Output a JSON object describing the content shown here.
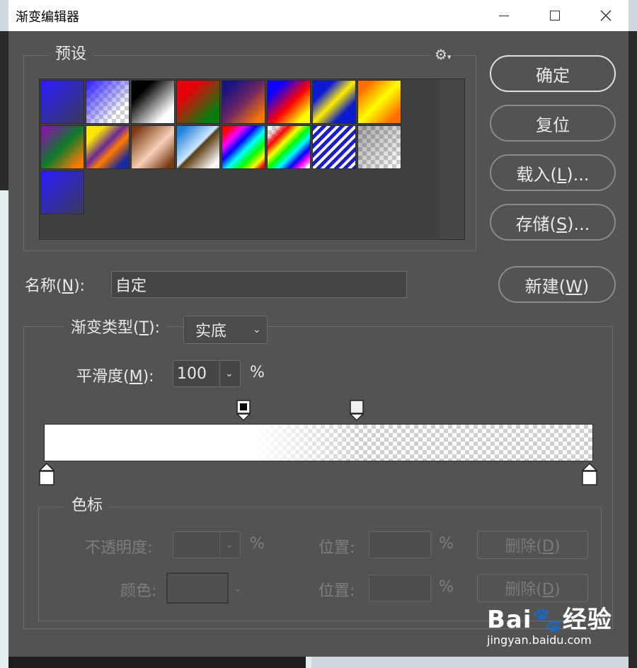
{
  "window": {
    "title": "渐变编辑器"
  },
  "presets": {
    "legend": "预设",
    "gear_icon": "gear-icon",
    "swatches": [
      {
        "name": "gradient-blue-gray"
      },
      {
        "name": "gradient-blue-transparent"
      },
      {
        "name": "gradient-black-white"
      },
      {
        "name": "gradient-red-green"
      },
      {
        "name": "gradient-violet-orange"
      },
      {
        "name": "gradient-blue-red-yellow"
      },
      {
        "name": "gradient-blue-yellow-blue"
      },
      {
        "name": "gradient-orange-yellow-orange"
      },
      {
        "name": "gradient-violet-green-orange"
      },
      {
        "name": "gradient-yellow-violet-orange-blue"
      },
      {
        "name": "gradient-copper"
      },
      {
        "name": "gradient-chrome"
      },
      {
        "name": "gradient-spectrum"
      },
      {
        "name": "gradient-transparent-rainbow"
      },
      {
        "name": "gradient-transparent-stripes"
      },
      {
        "name": "gradient-neutral-density"
      },
      {
        "name": "gradient-blue-gray-custom"
      }
    ]
  },
  "buttons": {
    "ok": "确定",
    "reset": "复位",
    "load_prefix": "载入(",
    "load_key": "L",
    "load_suffix": ")...",
    "save_prefix": "存储(",
    "save_key": "S",
    "save_suffix": ")...",
    "new_prefix": "新建(",
    "new_key": "W",
    "new_suffix": ")"
  },
  "name_field": {
    "label_prefix": "名称(",
    "label_key": "N",
    "label_suffix": "):",
    "value": "自定"
  },
  "gradient_type": {
    "label_prefix": "渐变类型(",
    "label_key": "T",
    "label_suffix": "):",
    "value": "实底"
  },
  "smoothness": {
    "label_prefix": "平滑度(",
    "label_key": "M",
    "label_suffix": "):",
    "value": "100",
    "unit": "%"
  },
  "color_stops": {
    "legend": "色标",
    "opacity_label": "不透明度:",
    "opacity_unit": "%",
    "color_label": "颜色:",
    "position_label_1": "位置:",
    "position_unit_1": "%",
    "position_label_2": "位置:",
    "position_unit_2": "%",
    "delete_prefix": "删除(",
    "delete_key": "D",
    "delete_suffix": ")"
  },
  "watermark": {
    "logo": "Bai🐾经验",
    "url": "jingyan.baidu.com"
  }
}
